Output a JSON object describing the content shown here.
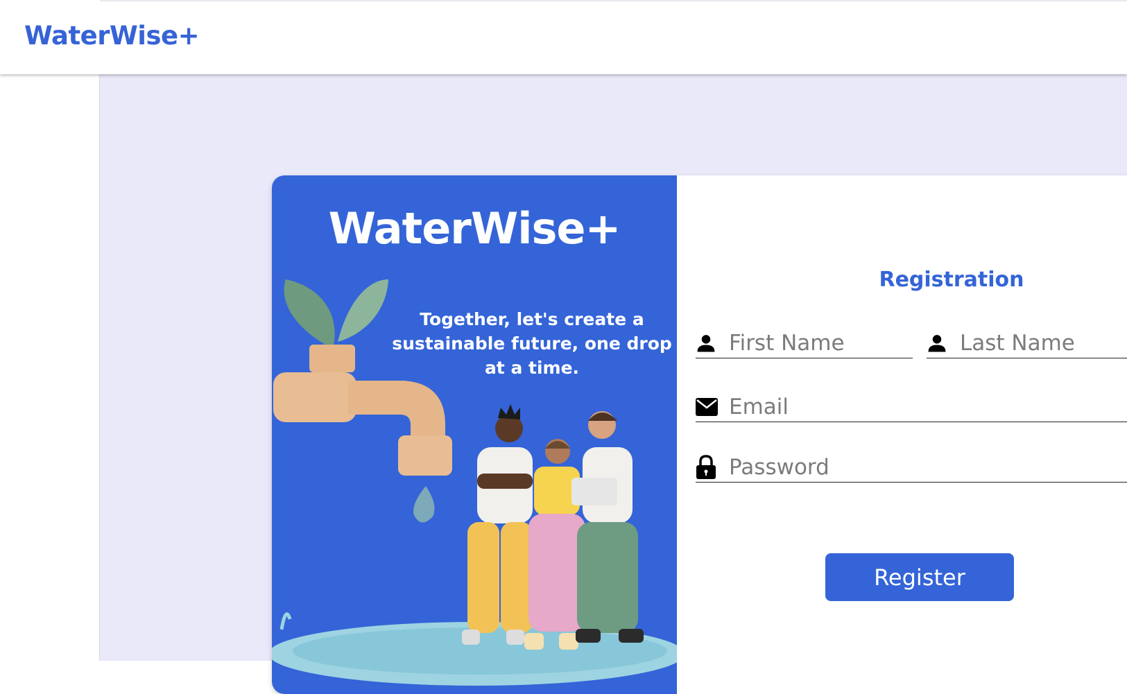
{
  "app": {
    "brand": "WaterWise+"
  },
  "promo": {
    "title": "WaterWise+",
    "tagline": "Together, let's create a sustainable future, one drop at a time."
  },
  "form": {
    "title": "Registration",
    "first_name": {
      "placeholder": "First Name",
      "value": "",
      "icon": "person-icon"
    },
    "last_name": {
      "placeholder": "Last Name",
      "value": "",
      "icon": "person-icon"
    },
    "email": {
      "placeholder": "Email",
      "value": "",
      "icon": "envelope-icon"
    },
    "password": {
      "placeholder": "Password",
      "value": "",
      "icon": "lock-icon"
    },
    "submit_label": "Register"
  },
  "colors": {
    "brand": "#3464d7",
    "page_background": "#e9e9fa",
    "card_background": "#ffffff"
  }
}
